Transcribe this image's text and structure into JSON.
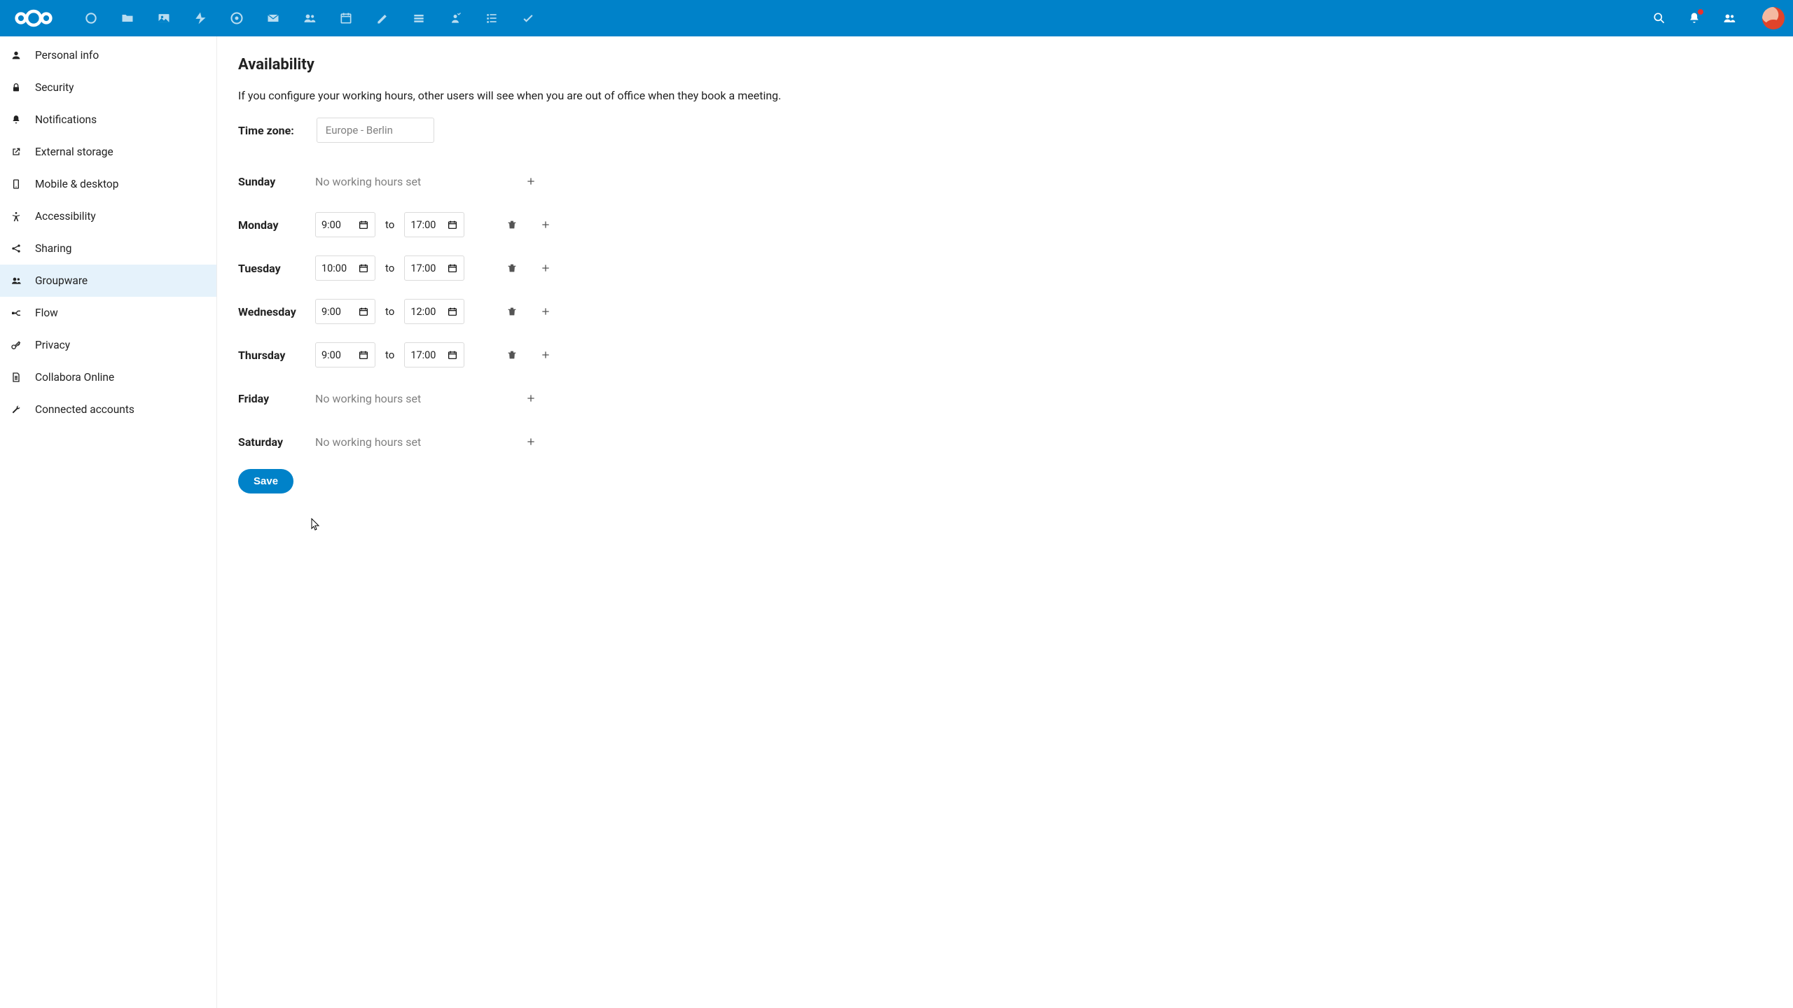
{
  "header": {
    "app_icons": [
      "dashboard",
      "files",
      "photos",
      "activity",
      "talk",
      "mail",
      "contacts",
      "calendar",
      "notes",
      "deck",
      "contacts2",
      "tasks",
      "checkmarks"
    ]
  },
  "sidebar": {
    "items": [
      {
        "icon": "user",
        "label": "Personal info"
      },
      {
        "icon": "lock",
        "label": "Security"
      },
      {
        "icon": "bell",
        "label": "Notifications"
      },
      {
        "icon": "external",
        "label": "External storage"
      },
      {
        "icon": "mobile",
        "label": "Mobile & desktop"
      },
      {
        "icon": "accessibility",
        "label": "Accessibility"
      },
      {
        "icon": "share",
        "label": "Sharing"
      },
      {
        "icon": "group",
        "label": "Groupware"
      },
      {
        "icon": "flow",
        "label": "Flow"
      },
      {
        "icon": "privacy",
        "label": "Privacy"
      },
      {
        "icon": "doc",
        "label": "Collabora Online"
      },
      {
        "icon": "wrench",
        "label": "Connected accounts"
      }
    ],
    "active_index": 7
  },
  "main": {
    "title": "Availability",
    "description": "If you configure your working hours, other users will see when you are out of office when they book a meeting.",
    "timezone_label": "Time zone:",
    "timezone_value": "Europe - Berlin",
    "no_hours_text": "No working hours set",
    "to_text": "to",
    "save_label": "Save",
    "days": [
      {
        "name": "Sunday",
        "slots": []
      },
      {
        "name": "Monday",
        "slots": [
          {
            "from": "9:00",
            "to": "17:00"
          }
        ]
      },
      {
        "name": "Tuesday",
        "slots": [
          {
            "from": "10:00",
            "to": "17:00"
          }
        ]
      },
      {
        "name": "Wednesday",
        "slots": [
          {
            "from": "9:00",
            "to": "12:00"
          }
        ]
      },
      {
        "name": "Thursday",
        "slots": [
          {
            "from": "9:00",
            "to": "17:00"
          }
        ]
      },
      {
        "name": "Friday",
        "slots": []
      },
      {
        "name": "Saturday",
        "slots": []
      }
    ]
  }
}
